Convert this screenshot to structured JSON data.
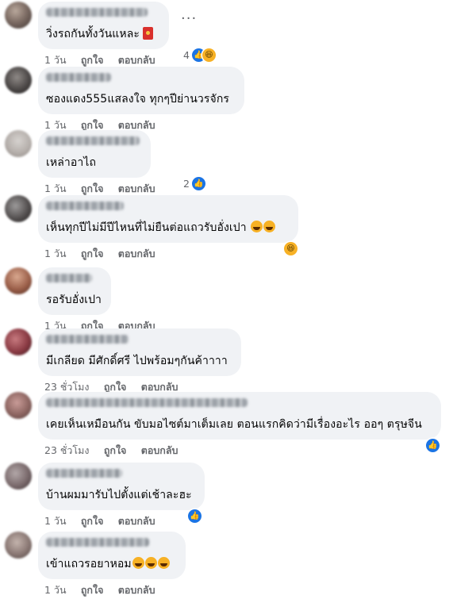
{
  "comments": [
    {
      "text": "วิ่งรถกันทั้งวันแหละ",
      "time": "1 วัน",
      "like": "ถูกใจ",
      "reply": "ตอบกลับ",
      "reaction_count": "4",
      "reactions": [
        "like-icon",
        "haha-icon"
      ],
      "emoji": "red-envelope-icon"
    },
    {
      "text": "ซองแดง555แสลงใจ ทุกๆปีย่านวรจักร",
      "time": "1 วัน",
      "like": "ถูกใจ",
      "reply": "ตอบกลับ",
      "reaction_count": "",
      "reactions": []
    },
    {
      "text": "เหล่าอาไถ",
      "time": "1 วัน",
      "like": "ถูกใจ",
      "reply": "ตอบกลับ",
      "reaction_count": "2",
      "reactions": [
        "like-icon"
      ]
    },
    {
      "text": "เห็นทุกปีไม่มีปีไหนที่ไม่ยืนต่อแถวรับอั่งเปา",
      "time": "1 วัน",
      "like": "ถูกใจ",
      "reply": "ตอบกลับ",
      "reaction_count": "",
      "reactions": [
        "haha-icon"
      ],
      "emoji_count": 2
    },
    {
      "text": "รอรับอั่งเปา",
      "time": "1 วัน",
      "like": "ถูกใจ",
      "reply": "ตอบกลับ",
      "reaction_count": "",
      "reactions": []
    },
    {
      "text": "มีเกลียด มีศักดิ์ศรี ไปพร้อมๆกันค้าาาา",
      "time": "23 ชั่วโมง",
      "like": "ถูกใจ",
      "reply": "ตอบกลับ",
      "reaction_count": "",
      "reactions": []
    },
    {
      "text": "เคยเห็นเหมือนกัน ขับมอไซต์มาเต็มเลย ตอนแรกคิดว่ามีเรื่องอะไร ออๆ ตรุษจีน",
      "time": "23 ชั่วโมง",
      "like": "ถูกใจ",
      "reply": "ตอบกลับ",
      "reaction_count": "",
      "reactions": [
        "like-icon"
      ]
    },
    {
      "text": "บ้านผมมารับไปตั้งแต่เช้าละฮะ",
      "time": "1 วัน",
      "like": "ถูกใจ",
      "reply": "ตอบกลับ",
      "reaction_count": "",
      "reactions": [
        "like-icon"
      ]
    },
    {
      "text": "เข้าแถวรอยาหอม",
      "time": "1 วัน",
      "like": "ถูกใจ",
      "reply": "ตอบกลับ",
      "reaction_count": "",
      "reactions": [],
      "emoji_count": 3
    }
  ],
  "more_options": "...",
  "colors": {
    "bubble": "#f0f2f5",
    "like": "#1b74e4",
    "haha": "#f7b125",
    "meta": "#65676b"
  }
}
